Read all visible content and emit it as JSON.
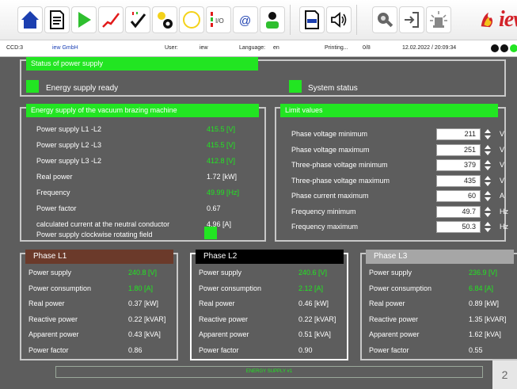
{
  "toolbar": {
    "icons": [
      "home-icon",
      "document-icon",
      "play-icon",
      "chart-icon",
      "check-icon",
      "settings-icon",
      "circle-icon",
      "io-icon",
      "email-icon",
      "user-icon",
      "pdf-icon",
      "speaker-icon",
      "search-icon",
      "logout-icon",
      "light-icon"
    ],
    "logo_text": "iew"
  },
  "statusbar": {
    "ccd": "CCD:3",
    "company": "iew GmbH",
    "user_label": "User:",
    "user": "iew",
    "language_label": "Language:",
    "language": "en",
    "printing": "Printing...",
    "print_count": "0/8",
    "datetime": "12.02.2022 / 20:09:34"
  },
  "power_status": {
    "title": "Status of power supply",
    "energy_ready": "Energy supply ready",
    "system_status": "System status"
  },
  "energy": {
    "title": "Energy supply of the vacuum brazing machine",
    "rows": [
      {
        "label": "Power supply L1 -L2",
        "value": "415.5 [V]",
        "highlight": true
      },
      {
        "label": "Power supply L2 -L3",
        "value": "415.5 [V]",
        "highlight": true
      },
      {
        "label": "Power supply L3 -L2",
        "value": "412.8 [V]",
        "highlight": true
      },
      {
        "label": "Real power",
        "value": "1.72 [kW]",
        "highlight": false
      },
      {
        "label": "Frequency",
        "value": "49.99 [Hz]",
        "highlight": true
      },
      {
        "label": "Power factor",
        "value": "0.67",
        "highlight": false
      },
      {
        "label": "calculated current at the neutral conductor",
        "value": "4.96 [A]",
        "highlight": false
      }
    ],
    "rotating_label": "Power supply clockwise rotating field"
  },
  "limits": {
    "title": "Limit values",
    "rows": [
      {
        "label": "Phase voltage minimum",
        "value": "211",
        "unit": "V"
      },
      {
        "label": "Phase voltage maximum",
        "value": "251",
        "unit": "V"
      },
      {
        "label": "Three-phase voltage minimum",
        "value": "379",
        "unit": "V"
      },
      {
        "label": "Three-phase voltage maximum",
        "value": "435",
        "unit": "V"
      },
      {
        "label": "Phase current maximum",
        "value": "60",
        "unit": "A"
      },
      {
        "label": "Frequency minimum",
        "value": "49.7",
        "unit": "Hz"
      },
      {
        "label": "Frequency maximum",
        "value": "50.3",
        "unit": "Hz"
      }
    ]
  },
  "phases": [
    {
      "title": "Phase L1",
      "header_color": "#6b3a2a",
      "border_color": "#c8c8c8",
      "rows": [
        {
          "label": "Power supply",
          "value": "240.8 [V]",
          "highlight": true
        },
        {
          "label": "Power consumption",
          "value": "1.80 [A]",
          "highlight": true
        },
        {
          "label": "Real power",
          "value": "0.37 [kW]",
          "highlight": false
        },
        {
          "label": "Reactive power",
          "value": "0.22 [kVAR]",
          "highlight": false
        },
        {
          "label": "Apparent power",
          "value": "0.43 [kVA]",
          "highlight": false
        },
        {
          "label": "Power factor",
          "value": "0.86",
          "highlight": false
        }
      ]
    },
    {
      "title": "Phase L2",
      "header_color": "#000000",
      "border_color": "#ffffff",
      "rows": [
        {
          "label": "Power supply",
          "value": "240.6 [V]",
          "highlight": true
        },
        {
          "label": "Power consumption",
          "value": "2.12 [A]",
          "highlight": true
        },
        {
          "label": "Real power",
          "value": "0.46 [kW]",
          "highlight": false
        },
        {
          "label": "Reactive power",
          "value": "0.22 [kVAR]",
          "highlight": false
        },
        {
          "label": "Apparent power",
          "value": "0.51 [kVA]",
          "highlight": false
        },
        {
          "label": "Power factor",
          "value": "0.90",
          "highlight": false
        }
      ]
    },
    {
      "title": "Phase L3",
      "header_color": "#a6a6a6",
      "border_color": "#c8c8c8",
      "rows": [
        {
          "label": "Power supply",
          "value": "236.9 [V]",
          "highlight": true
        },
        {
          "label": "Power consumption",
          "value": "6.84 [A]",
          "highlight": true
        },
        {
          "label": "Real power",
          "value": "0.89 [kW]",
          "highlight": false
        },
        {
          "label": "Reactive power",
          "value": "1.35 [kVAR]",
          "highlight": false
        },
        {
          "label": "Apparent power",
          "value": "1.62 [kVA]",
          "highlight": false
        },
        {
          "label": "Power factor",
          "value": "0.55",
          "highlight": false
        }
      ]
    }
  ],
  "footer": {
    "label": "ENERGY SUPPLY #1",
    "page": "2"
  },
  "colors": {
    "accent_green": "#22e522",
    "background": "#5d5d5d",
    "panel_border": "#c8c8c8",
    "logo_red": "#d3232a"
  }
}
